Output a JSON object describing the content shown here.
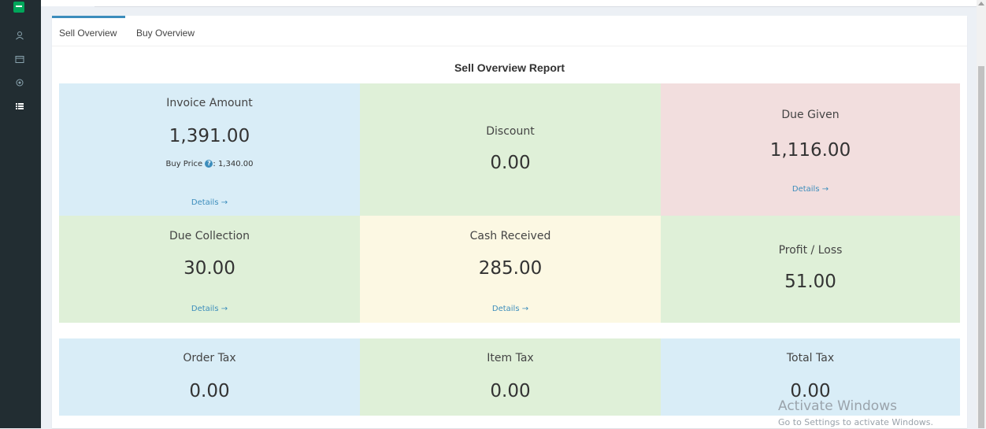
{
  "sidebar": {
    "icons": [
      "chat-icon",
      "users-icon",
      "folder-icon",
      "settings-icon",
      "list-icon"
    ]
  },
  "tabs": [
    {
      "label": "Sell Overview",
      "active": true
    },
    {
      "label": "Buy Overview",
      "active": false
    }
  ],
  "report": {
    "title": "Sell Overview Report"
  },
  "cards": {
    "invoice_amount": {
      "label": "Invoice Amount",
      "value": "1,391.00",
      "buy_price_label": "Buy Price",
      "buy_price_value": ": 1,340.00",
      "link": "Details →"
    },
    "discount": {
      "label": "Discount",
      "value": "0.00"
    },
    "due_given": {
      "label": "Due Given",
      "value": "1,116.00",
      "link": "Details →"
    },
    "due_collection": {
      "label": "Due Collection",
      "value": "30.00",
      "link": "Details →"
    },
    "cash_received": {
      "label": "Cash Received",
      "value": "285.00",
      "link": "Details →"
    },
    "profit_loss": {
      "label": "Profit / Loss",
      "value": "51.00"
    },
    "order_tax": {
      "label": "Order Tax",
      "value": "0.00"
    },
    "item_tax": {
      "label": "Item Tax",
      "value": "0.00"
    },
    "total_tax": {
      "label": "Total Tax",
      "value": "0.00"
    }
  },
  "watermark": {
    "line1": "Activate Windows",
    "line2": "Go to Settings to activate Windows."
  },
  "colors": {
    "sidebar_bg": "#222d32",
    "accent": "#3c8dbc",
    "box_blue": "#d9edf7",
    "box_green": "#dff0d8",
    "box_red": "#f2dede",
    "box_yellow": "#fcf8e3"
  }
}
